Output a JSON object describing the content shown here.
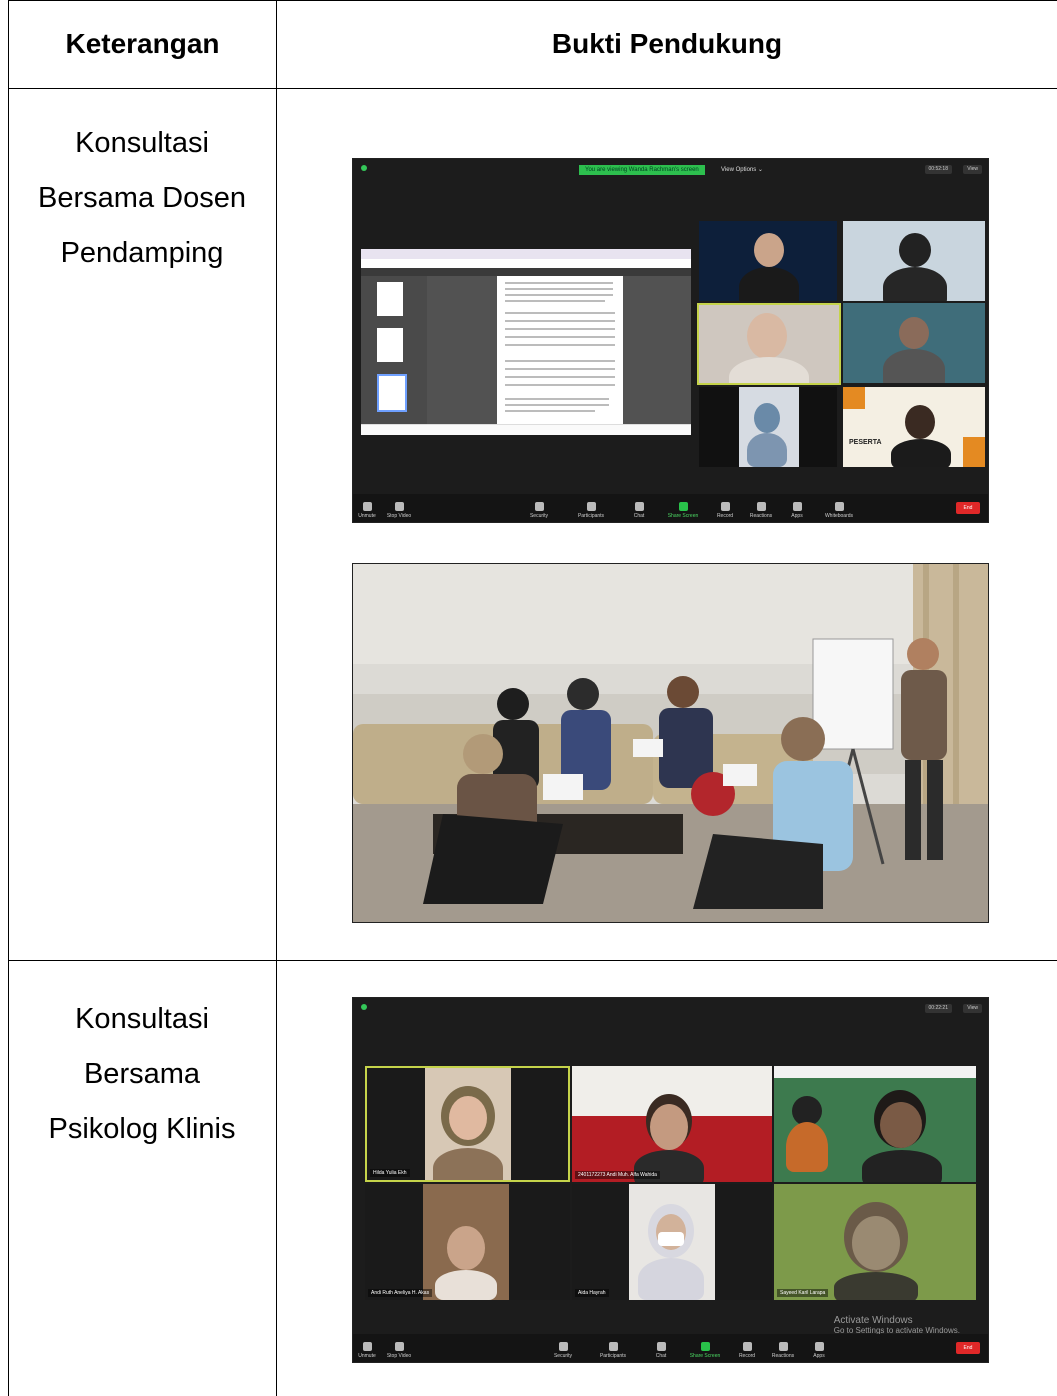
{
  "table": {
    "headers": [
      "Keterangan",
      "Bukti Pendukung"
    ]
  },
  "rows": [
    {
      "keterangan": [
        "Konsultasi",
        "Bersama Dosen",
        "Pendamping"
      ]
    },
    {
      "keterangan": [
        "Konsultasi",
        "Bersama",
        "Psikolog Klinis"
      ]
    }
  ],
  "zoom1": {
    "banner": "You are viewing Wanda Rachman's screen",
    "view_options": "View Options ⌄",
    "tag": "00:52:18",
    "view_label": "View",
    "toolbar": [
      "Unmute",
      "Stop Video",
      "Security",
      "Participants",
      "Chat",
      "Share Screen",
      "Record",
      "Reactions",
      "Apps",
      "Whiteboards"
    ],
    "end_label": "End",
    "tile_label": "PESERTA"
  },
  "zoom2": {
    "tag": "00:22:21",
    "view_label": "View",
    "names": [
      "Hilda Yulia Ekh",
      "2401172273 Andi Muh. Alfa Wahida",
      "",
      "Andi Ruth Aneliya H. Akas",
      "Aida Hayrah",
      "Sayeed Karil Larapa"
    ],
    "toolbar": [
      "Unmute",
      "Stop Video",
      "Security",
      "Participants",
      "Chat",
      "Share Screen",
      "Record",
      "Reactions",
      "Apps"
    ],
    "end_label": "End",
    "watermark_title": "Activate Windows",
    "watermark_sub": "Go to Settings to activate Windows."
  },
  "colors": {
    "zoom_bg": "#1c1c1c",
    "active_speaker": "#c5d34a",
    "banner_green": "#2dbf4e",
    "end_red": "#e02828"
  }
}
